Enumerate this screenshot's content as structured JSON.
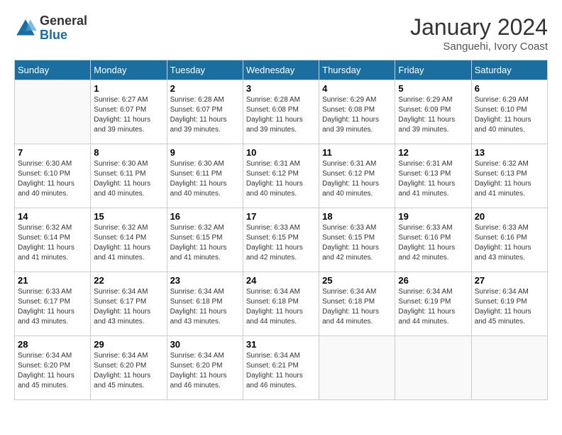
{
  "logo": {
    "general": "General",
    "blue": "Blue"
  },
  "title": "January 2024",
  "location": "Sanguehi, Ivory Coast",
  "days_of_week": [
    "Sunday",
    "Monday",
    "Tuesday",
    "Wednesday",
    "Thursday",
    "Friday",
    "Saturday"
  ],
  "weeks": [
    [
      {
        "day": "",
        "empty": true
      },
      {
        "day": "1",
        "sunrise": "6:27 AM",
        "sunset": "6:07 PM",
        "daylight": "11 hours and 39 minutes."
      },
      {
        "day": "2",
        "sunrise": "6:28 AM",
        "sunset": "6:07 PM",
        "daylight": "11 hours and 39 minutes."
      },
      {
        "day": "3",
        "sunrise": "6:28 AM",
        "sunset": "6:08 PM",
        "daylight": "11 hours and 39 minutes."
      },
      {
        "day": "4",
        "sunrise": "6:29 AM",
        "sunset": "6:08 PM",
        "daylight": "11 hours and 39 minutes."
      },
      {
        "day": "5",
        "sunrise": "6:29 AM",
        "sunset": "6:09 PM",
        "daylight": "11 hours and 39 minutes."
      },
      {
        "day": "6",
        "sunrise": "6:29 AM",
        "sunset": "6:10 PM",
        "daylight": "11 hours and 40 minutes."
      }
    ],
    [
      {
        "day": "7",
        "sunrise": "6:30 AM",
        "sunset": "6:10 PM",
        "daylight": "11 hours and 40 minutes."
      },
      {
        "day": "8",
        "sunrise": "6:30 AM",
        "sunset": "6:11 PM",
        "daylight": "11 hours and 40 minutes."
      },
      {
        "day": "9",
        "sunrise": "6:30 AM",
        "sunset": "6:11 PM",
        "daylight": "11 hours and 40 minutes."
      },
      {
        "day": "10",
        "sunrise": "6:31 AM",
        "sunset": "6:12 PM",
        "daylight": "11 hours and 40 minutes."
      },
      {
        "day": "11",
        "sunrise": "6:31 AM",
        "sunset": "6:12 PM",
        "daylight": "11 hours and 40 minutes."
      },
      {
        "day": "12",
        "sunrise": "6:31 AM",
        "sunset": "6:13 PM",
        "daylight": "11 hours and 41 minutes."
      },
      {
        "day": "13",
        "sunrise": "6:32 AM",
        "sunset": "6:13 PM",
        "daylight": "11 hours and 41 minutes."
      }
    ],
    [
      {
        "day": "14",
        "sunrise": "6:32 AM",
        "sunset": "6:14 PM",
        "daylight": "11 hours and 41 minutes."
      },
      {
        "day": "15",
        "sunrise": "6:32 AM",
        "sunset": "6:14 PM",
        "daylight": "11 hours and 41 minutes."
      },
      {
        "day": "16",
        "sunrise": "6:32 AM",
        "sunset": "6:15 PM",
        "daylight": "11 hours and 41 minutes."
      },
      {
        "day": "17",
        "sunrise": "6:33 AM",
        "sunset": "6:15 PM",
        "daylight": "11 hours and 42 minutes."
      },
      {
        "day": "18",
        "sunrise": "6:33 AM",
        "sunset": "6:15 PM",
        "daylight": "11 hours and 42 minutes."
      },
      {
        "day": "19",
        "sunrise": "6:33 AM",
        "sunset": "6:16 PM",
        "daylight": "11 hours and 42 minutes."
      },
      {
        "day": "20",
        "sunrise": "6:33 AM",
        "sunset": "6:16 PM",
        "daylight": "11 hours and 43 minutes."
      }
    ],
    [
      {
        "day": "21",
        "sunrise": "6:33 AM",
        "sunset": "6:17 PM",
        "daylight": "11 hours and 43 minutes."
      },
      {
        "day": "22",
        "sunrise": "6:34 AM",
        "sunset": "6:17 PM",
        "daylight": "11 hours and 43 minutes."
      },
      {
        "day": "23",
        "sunrise": "6:34 AM",
        "sunset": "6:18 PM",
        "daylight": "11 hours and 43 minutes."
      },
      {
        "day": "24",
        "sunrise": "6:34 AM",
        "sunset": "6:18 PM",
        "daylight": "11 hours and 44 minutes."
      },
      {
        "day": "25",
        "sunrise": "6:34 AM",
        "sunset": "6:18 PM",
        "daylight": "11 hours and 44 minutes."
      },
      {
        "day": "26",
        "sunrise": "6:34 AM",
        "sunset": "6:19 PM",
        "daylight": "11 hours and 44 minutes."
      },
      {
        "day": "27",
        "sunrise": "6:34 AM",
        "sunset": "6:19 PM",
        "daylight": "11 hours and 45 minutes."
      }
    ],
    [
      {
        "day": "28",
        "sunrise": "6:34 AM",
        "sunset": "6:20 PM",
        "daylight": "11 hours and 45 minutes."
      },
      {
        "day": "29",
        "sunrise": "6:34 AM",
        "sunset": "6:20 PM",
        "daylight": "11 hours and 45 minutes."
      },
      {
        "day": "30",
        "sunrise": "6:34 AM",
        "sunset": "6:20 PM",
        "daylight": "11 hours and 46 minutes."
      },
      {
        "day": "31",
        "sunrise": "6:34 AM",
        "sunset": "6:21 PM",
        "daylight": "11 hours and 46 minutes."
      },
      {
        "day": "",
        "empty": true
      },
      {
        "day": "",
        "empty": true
      },
      {
        "day": "",
        "empty": true
      }
    ]
  ],
  "labels": {
    "sunrise": "Sunrise:",
    "sunset": "Sunset:",
    "daylight": "Daylight:"
  }
}
